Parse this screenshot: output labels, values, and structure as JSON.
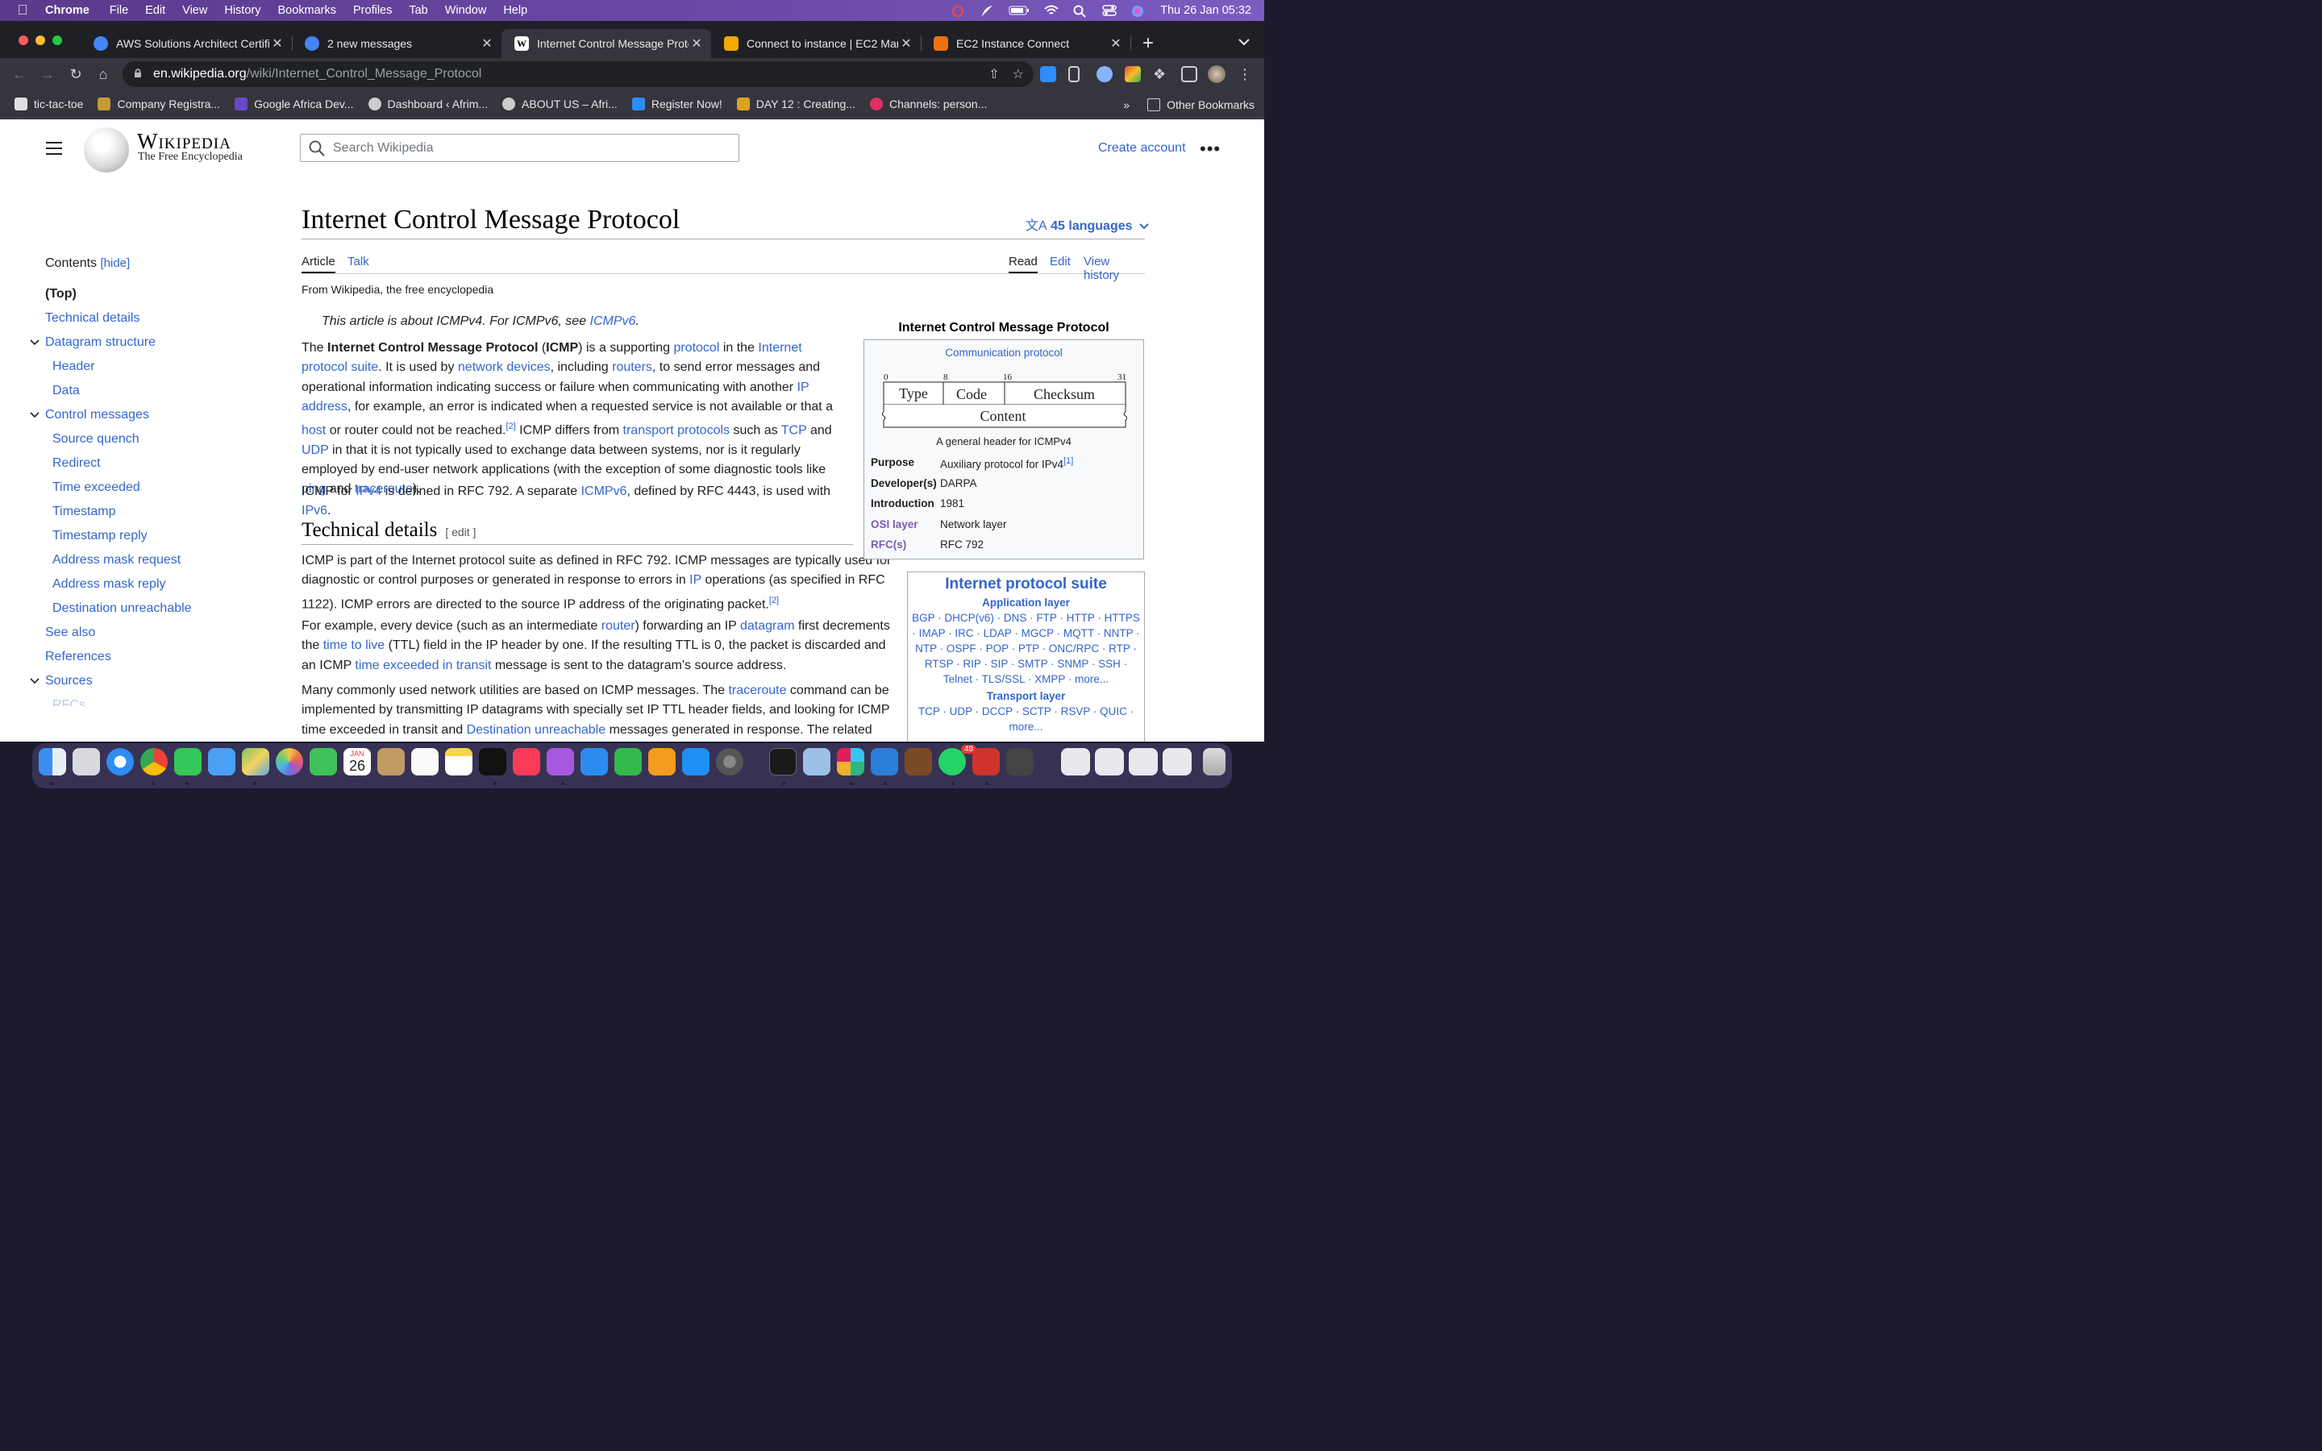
{
  "menubar": {
    "app": "Chrome",
    "items": [
      "File",
      "Edit",
      "View",
      "History",
      "Bookmarks",
      "Profiles",
      "Tab",
      "Window",
      "Help"
    ],
    "clock": "Thu 26 Jan  05:32"
  },
  "tabs": [
    {
      "title": "AWS Solutions Architect Certifi",
      "color": "#4285f4"
    },
    {
      "title": "2 new messages",
      "color": "#4285f4"
    },
    {
      "title": "Internet Control Message Proto",
      "color": "#ffffff",
      "glyph": "W"
    },
    {
      "title": "Connect to instance | EC2 Man",
      "color": "#f2a900"
    },
    {
      "title": "EC2 Instance Connect",
      "color": "#ec7211"
    }
  ],
  "address": {
    "host": "en.wikipedia.org",
    "path": "/wiki/Internet_Control_Message_Protocol"
  },
  "bookmarks": [
    "tic-tac-toe",
    "Company Registra...",
    "Google Africa Dev...",
    "Dashboard ‹ Afrim...",
    "ABOUT US – Afri...",
    "Register Now!",
    "DAY 12 : Creating...",
    "Channels: person..."
  ],
  "bookmark_colors": [
    "#e0e0e0",
    "#c59a3a",
    "#6b45c8",
    "#cccccc",
    "#cccccc",
    "#2d8cff",
    "#d9a520",
    "#e03060"
  ],
  "other_bookmarks": "Other Bookmarks",
  "wiki": {
    "wordmark": "Wikipedia",
    "tagline": "The Free Encyclopedia",
    "search_placeholder": "Search Wikipedia",
    "create_account": "Create account"
  },
  "toc": {
    "heading": "Contents",
    "hide": "[hide]",
    "items": [
      {
        "label": "(Top)",
        "level": 1,
        "top": true
      },
      {
        "label": "Technical details",
        "level": 1
      },
      {
        "label": "Datagram structure",
        "level": 1,
        "expand": true
      },
      {
        "label": "Header",
        "level": 2
      },
      {
        "label": "Data",
        "level": 2
      },
      {
        "label": "Control messages",
        "level": 1,
        "expand": true
      },
      {
        "label": "Source quench",
        "level": 2
      },
      {
        "label": "Redirect",
        "level": 2
      },
      {
        "label": "Time exceeded",
        "level": 2
      },
      {
        "label": "Timestamp",
        "level": 2
      },
      {
        "label": "Timestamp reply",
        "level": 2
      },
      {
        "label": "Address mask request",
        "level": 2
      },
      {
        "label": "Address mask reply",
        "level": 2
      },
      {
        "label": "Destination unreachable",
        "level": 2
      },
      {
        "label": "See also",
        "level": 1
      },
      {
        "label": "References",
        "level": 1
      },
      {
        "label": "Sources",
        "level": 1,
        "expand": true
      },
      {
        "label": "RFCs",
        "level": 2
      }
    ]
  },
  "article": {
    "title": "Internet Control Message Protocol",
    "languages": "45 languages",
    "tabs_left": [
      "Article",
      "Talk"
    ],
    "tabs_right": [
      "Read",
      "Edit",
      "View history"
    ],
    "from": "From Wikipedia, the free encyclopedia",
    "hatnote_pre": "This article is about ICMPv4. For ICMPv6, see ",
    "hatnote_link": "ICMPv6",
    "hatnote_post": ".",
    "section_title": "Technical details",
    "section_edit": "[ edit ]"
  },
  "infobox": {
    "title": "Internet Control Message Protocol",
    "subtitle": "Communication protocol",
    "diagram": {
      "bits": [
        "0",
        "8",
        "16",
        "31"
      ],
      "fields": [
        "Type",
        "Code",
        "Checksum"
      ],
      "content": "Content"
    },
    "caption": "A general header for ICMPv4",
    "rows": [
      {
        "label": "Purpose",
        "value": "Auxiliary protocol for IPv4",
        "ref": "[1]"
      },
      {
        "label": "Developer(s)",
        "value": "DARPA",
        "link": true
      },
      {
        "label": "Introduction",
        "value": "1981"
      },
      {
        "label": "OSI layer",
        "value": "Network layer",
        "link": true,
        "label_link": true
      },
      {
        "label": "RFC(s)",
        "value": "RFC 792",
        "label_link": true
      }
    ]
  },
  "navbox": {
    "title": "Internet protocol suite",
    "app_layer": "Application layer",
    "app_items": "BGP · DHCP(v6) · DNS · FTP · HTTP · HTTPS · IMAP · IRC · LDAP · MGCP · MQTT · NNTP · NTP · OSPF · POP · PTP · ONC/RPC · RTP · RTSP · RIP · SIP · SMTP · SNMP · SSH · Telnet · TLS/SSL · XMPP · more...",
    "transport_layer": "Transport layer",
    "transport_items": "TCP · UDP · DCCP · SCTP · RSVP · QUIC · more..."
  },
  "dock": {
    "badge_whatsapp": "48",
    "calendar_month": "JAN",
    "calendar_day": "26"
  }
}
